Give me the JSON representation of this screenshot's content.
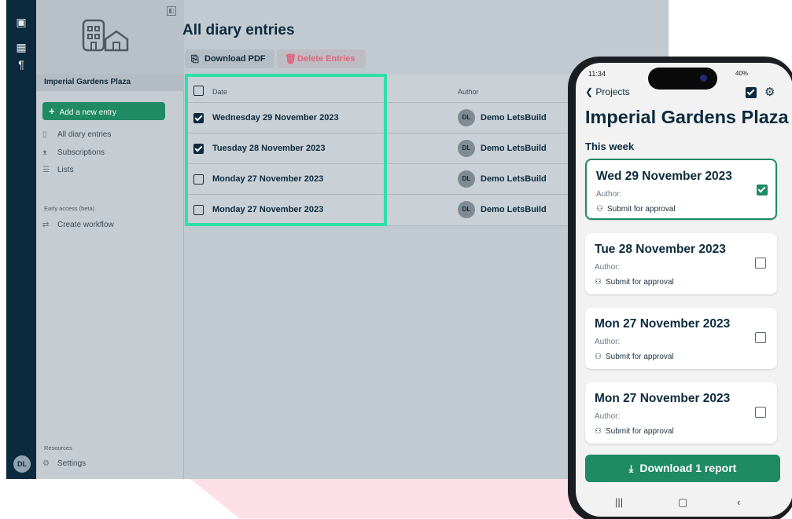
{
  "sidebar": {
    "project_name": "Imperial Gardens Plaza",
    "add_entry_label": "Add a new entry",
    "nav_items": [
      {
        "icon": "diary-icon",
        "label": "All diary entries"
      },
      {
        "icon": "people-icon",
        "label": "Subscriptions"
      },
      {
        "icon": "list-icon",
        "label": "Lists"
      }
    ],
    "early_access_label": "Early access (beta)",
    "workflow_label": "Create workflow",
    "resources_label": "Resources",
    "settings_label": "Settings",
    "user_initials": "DL"
  },
  "main": {
    "title": "All diary entries",
    "download_pdf_label": "Download PDF",
    "delete_entries_label": "Delete Entries",
    "table": {
      "columns": [
        "Date",
        "Author"
      ],
      "rows": [
        {
          "date": "Wednesday 29 November 2023",
          "author_initials": "DL",
          "author": "Demo LetsBuild",
          "checked": true
        },
        {
          "date": "Tuesday 28 November 2023",
          "author_initials": "DL",
          "author": "Demo LetsBuild",
          "checked": true
        },
        {
          "date": "Monday 27 November 2023",
          "author_initials": "DL",
          "author": "Demo LetsBuild",
          "checked": false
        },
        {
          "date": "Monday 27 November 2023",
          "author_initials": "DL",
          "author": "Demo LetsBuild",
          "checked": false
        }
      ]
    }
  },
  "mobile": {
    "status_time": "11:34",
    "status_right": "40%",
    "back_label": "Projects",
    "title": "Imperial Gardens Plaza",
    "week_label": "This week",
    "cards": [
      {
        "date": "Wed 29 November 2023",
        "author_label": "Author:",
        "status": "Submit for approval",
        "checked": true
      },
      {
        "date": "Tue 28 November 2023",
        "author_label": "Author:",
        "status": "Submit for approval",
        "checked": false
      },
      {
        "date": "Mon 27 November 2023",
        "author_label": "Author:",
        "status": "Submit for approval",
        "checked": false
      },
      {
        "date": "Mon 27 November 2023",
        "author_label": "Author:",
        "status": "Submit for approval",
        "checked": false
      }
    ],
    "download_label": "Download 1 report"
  },
  "colors": {
    "navy": "#0c2a3d",
    "green": "#1f8a64",
    "highlight": "#2fe0a6",
    "delete": "#e0647a",
    "pink_bg": "#fde0e5"
  }
}
